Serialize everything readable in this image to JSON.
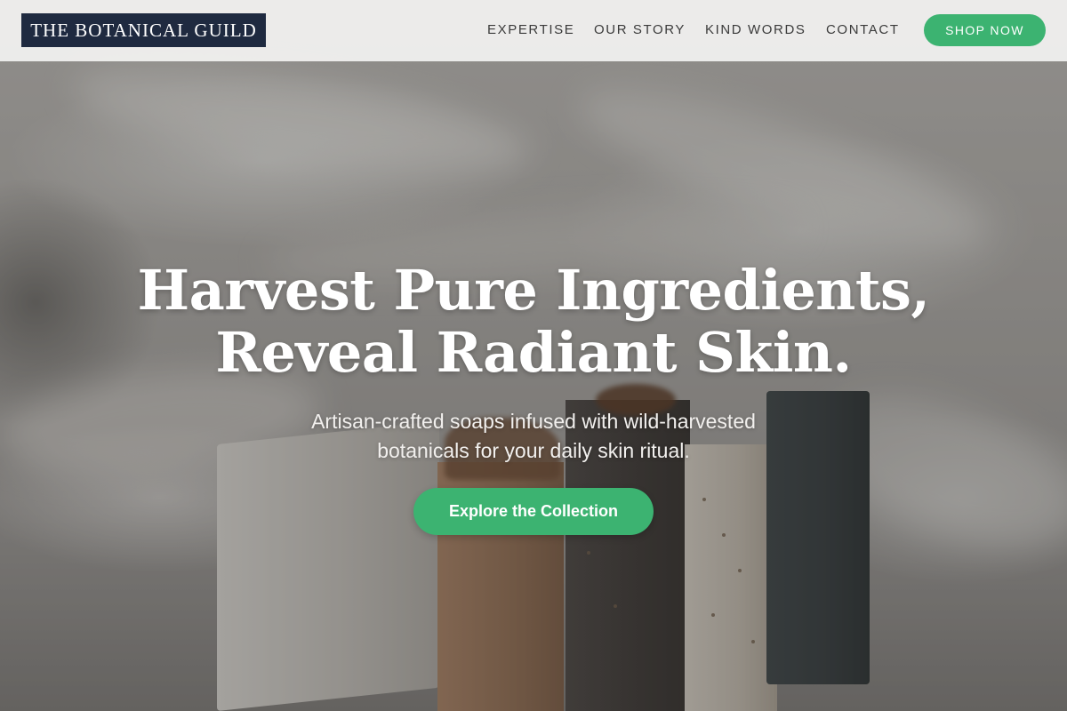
{
  "brand": {
    "logo_text": "THE BOTANICAL GUILD"
  },
  "nav": {
    "items": [
      {
        "label": "EXPERTISE"
      },
      {
        "label": "OUR STORY"
      },
      {
        "label": "KIND WORDS"
      },
      {
        "label": "CONTACT"
      }
    ],
    "shop_button": "SHOP NOW"
  },
  "hero": {
    "title_line1": "Harvest Pure Ingredients,",
    "title_line2": "Reveal Radiant Skin.",
    "subtitle_line1": "Artisan-crafted soaps infused with wild-harvested",
    "subtitle_line2": "botanicals for your daily skin ritual.",
    "cta_label": "Explore the Collection",
    "background_image": "handmade-soap-bars-photo"
  },
  "colors": {
    "accent": "#3cb371",
    "logo_bg": "#1f2a40",
    "header_bg": "#eeeeed",
    "nav_text": "#3b3b3b"
  }
}
